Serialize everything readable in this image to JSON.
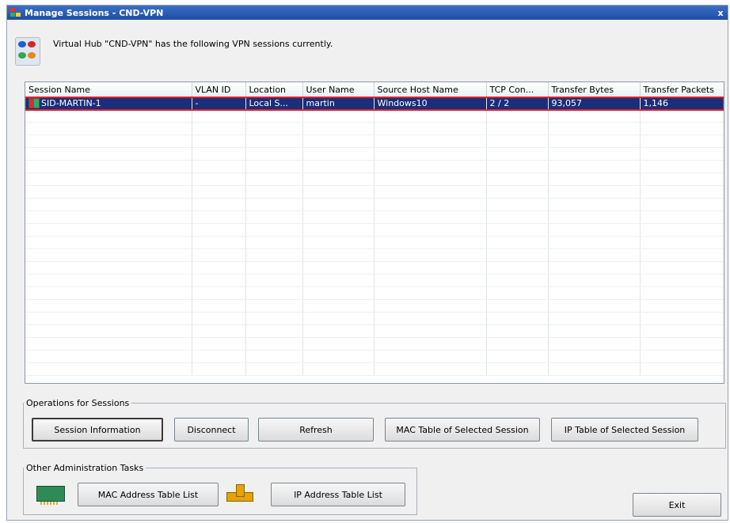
{
  "window": {
    "title": "Manage Sessions - CND-VPN",
    "close_label": "x"
  },
  "header": {
    "description": "Virtual Hub \"CND-VPN\" has the following VPN sessions currently."
  },
  "table": {
    "columns": [
      "Session Name",
      "VLAN ID",
      "Location",
      "User Name",
      "Source Host Name",
      "TCP Con...",
      "Transfer Bytes",
      "Transfer Packets"
    ],
    "rows": [
      [
        "SID-MARTIN-1",
        "-",
        "Local S...",
        "martin",
        "Windows10",
        "2 / 2",
        "93,057",
        "1,146"
      ]
    ]
  },
  "ops": {
    "legend": "Operations for Sessions",
    "session_info": "Session Information",
    "disconnect": "Disconnect",
    "refresh": "Refresh",
    "mac_table": "MAC Table of Selected Session",
    "ip_table": "IP Table of Selected Session"
  },
  "admin": {
    "legend": "Other Administration Tasks",
    "mac_list": "MAC Address Table List",
    "ip_list": "IP Address Table List"
  },
  "exit_label": "Exit",
  "colors": {
    "selection": "#1a2f7a",
    "highlight_border": "#e0202a",
    "title_bar": "#1d4fa3"
  }
}
